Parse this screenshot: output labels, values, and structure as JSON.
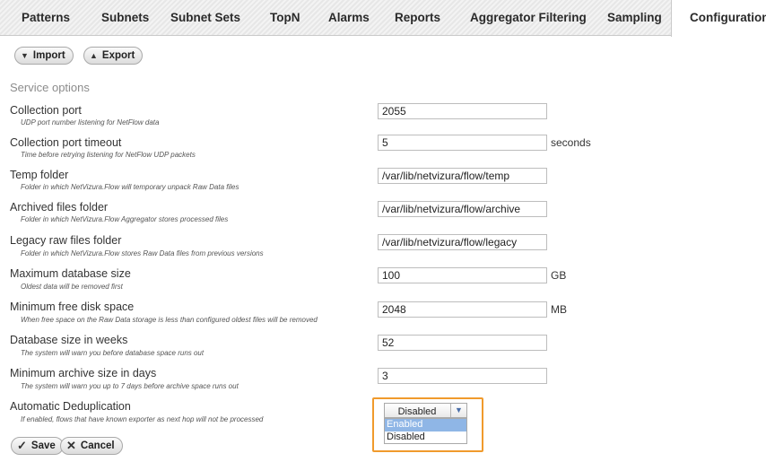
{
  "tabs": [
    {
      "label": "Patterns"
    },
    {
      "label": "Subnets"
    },
    {
      "label": "Subnet Sets"
    },
    {
      "label": "TopN"
    },
    {
      "label": "Alarms"
    },
    {
      "label": "Reports"
    },
    {
      "label": "Aggregator Filtering"
    },
    {
      "label": "Sampling"
    },
    {
      "label": "Configuration",
      "active": true
    }
  ],
  "toolbar": {
    "import_label": "Import",
    "export_label": "Export"
  },
  "section_title": "Service options",
  "options": [
    {
      "label": "Collection port",
      "desc": "UDP port number listening for NetFlow data",
      "value": "2055",
      "unit": ""
    },
    {
      "label": "Collection port timeout",
      "desc": "Time before retrying listening for NetFlow UDP packets",
      "value": "5",
      "unit": "seconds"
    },
    {
      "label": "Temp folder",
      "desc": "Folder in which NetVizura.Flow will temporary unpack Raw Data files",
      "value": "/var/lib/netvizura/flow/temp",
      "unit": ""
    },
    {
      "label": "Archived files folder",
      "desc": "Folder in which NetVizura.Flow Aggregator stores processed files",
      "value": "/var/lib/netvizura/flow/archive",
      "unit": ""
    },
    {
      "label": "Legacy raw files folder",
      "desc": "Folder in which NetVizura.Flow stores Raw Data files from previous versions",
      "value": "/var/lib/netvizura/flow/legacy",
      "unit": ""
    },
    {
      "label": "Maximum database size",
      "desc": "Oldest data will be removed first",
      "value": "100",
      "unit": "GB"
    },
    {
      "label": "Minimum free disk space",
      "desc": "When free space on the Raw Data storage is less than configured oldest files will be removed",
      "value": "2048",
      "unit": "MB"
    },
    {
      "label": "Database size in weeks",
      "desc": "The system will warn you before database space runs out",
      "value": "52",
      "unit": ""
    },
    {
      "label": "Minimum archive size in days",
      "desc": "The system will warn you up to 7 days before archive space runs out",
      "value": "3",
      "unit": ""
    }
  ],
  "dedup": {
    "label": "Automatic Deduplication",
    "desc": "If enabled, flows that have known exporter as next hop will not be processed",
    "selected": "Disabled",
    "options": [
      "Enabled",
      "Disabled"
    ],
    "highlight_color": "#f09a2c"
  },
  "actions": {
    "save_label": "Save",
    "cancel_label": "Cancel"
  }
}
